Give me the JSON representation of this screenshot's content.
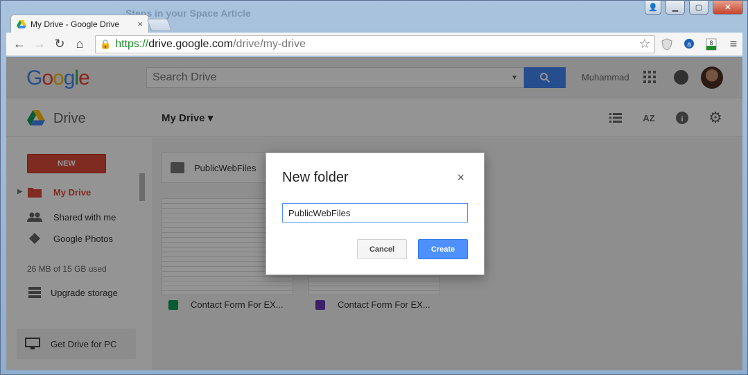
{
  "behind_window": {
    "title": "Steps in your Space Article"
  },
  "browser": {
    "tab_title": "My Drive - Google Drive",
    "tab_close": "×",
    "url_scheme": "https://",
    "url_host": "drive.google.com",
    "url_path": "/drive/my-drive",
    "star": "☆",
    "menu": "≡",
    "ext_counter": "8"
  },
  "header": {
    "logo": [
      "G",
      "o",
      "o",
      "g",
      "l",
      "e"
    ],
    "logo_colors": [
      "#4285f4",
      "#ea4335",
      "#fbbc05",
      "#4285f4",
      "#34a853",
      "#ea4335"
    ],
    "search_placeholder": "Search Drive",
    "username": "Muhammad"
  },
  "subbar": {
    "title": "Drive",
    "location": "My Drive",
    "caret": "▾",
    "sort_label": "AZ",
    "info": "i"
  },
  "sidebar": {
    "new_label": "NEW",
    "items": [
      {
        "label": "My Drive",
        "icon": "drive-folder-icon"
      },
      {
        "label": "Shared with me",
        "icon": "people-icon"
      },
      {
        "label": "Google Photos",
        "icon": "photos-icon"
      }
    ],
    "quota": "26 MB of 15 GB used",
    "upgrade": "Upgrade storage",
    "get_drive": "Get Drive for PC"
  },
  "content": {
    "folders": [
      {
        "name": "PublicWebFiles"
      }
    ],
    "files": [
      {
        "name": "Contact Form For EX...",
        "icon": "sheets-icon",
        "color": "#0f9d58"
      },
      {
        "name": "Contact Form For EX...",
        "icon": "forms-icon",
        "color": "#673ab7"
      }
    ]
  },
  "dialog": {
    "title": "New folder",
    "close": "×",
    "input_value": "PublicWebFiles",
    "cancel": "Cancel",
    "create": "Create"
  },
  "colors": {
    "accent": "#4285f4",
    "new_button": "#dd4b39",
    "active_item": "#dd4b39"
  }
}
